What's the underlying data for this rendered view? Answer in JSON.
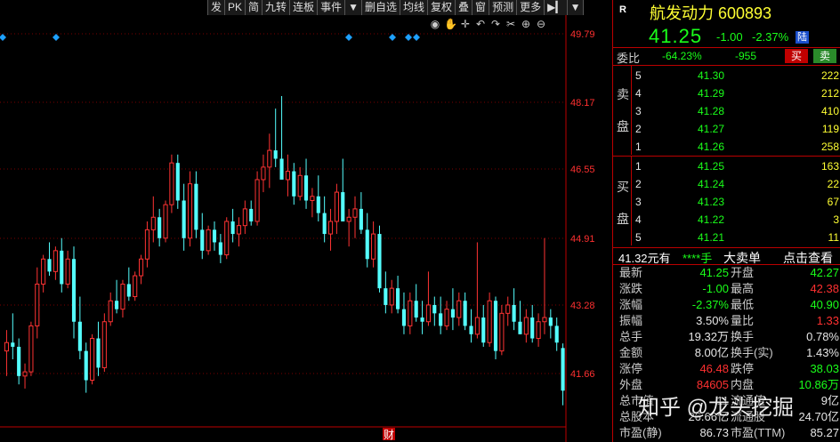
{
  "toolbar": {
    "buttons": [
      "发",
      "PK",
      "简",
      "九转",
      "连板",
      "事件",
      "▼",
      "删自选",
      "均线",
      "复权",
      "叠",
      "窗",
      "预测",
      "更多",
      "▶▎",
      "▼"
    ]
  },
  "chart": {
    "price_labels": [
      "49.79",
      "48.17",
      "46.55",
      "44.91",
      "43.28",
      "41.66"
    ],
    "bottom_marker": "财",
    "candles": [
      [
        42.2,
        42.7,
        41.6,
        42.4
      ],
      [
        42.4,
        43.1,
        42.0,
        42.3
      ],
      [
        42.3,
        42.5,
        41.4,
        41.6
      ],
      [
        41.6,
        41.9,
        41.3,
        41.7
      ],
      [
        41.7,
        42.9,
        41.6,
        42.8
      ],
      [
        42.8,
        44.2,
        42.5,
        43.8
      ],
      [
        43.8,
        44.5,
        43.6,
        44.4
      ],
      [
        44.4,
        44.8,
        44.0,
        44.1
      ],
      [
        44.1,
        44.7,
        43.9,
        44.6
      ],
      [
        44.6,
        44.9,
        43.6,
        43.8
      ],
      [
        43.8,
        44.6,
        43.7,
        44.4
      ],
      [
        44.4,
        44.7,
        42.5,
        42.9
      ],
      [
        42.9,
        43.5,
        42.0,
        42.2
      ],
      [
        42.2,
        42.4,
        41.2,
        41.5
      ],
      [
        41.5,
        42.6,
        41.4,
        42.5
      ],
      [
        42.5,
        42.9,
        41.6,
        41.8
      ],
      [
        41.8,
        43.1,
        41.7,
        42.9
      ],
      [
        42.9,
        43.6,
        42.8,
        43.4
      ],
      [
        43.4,
        43.9,
        43.1,
        43.2
      ],
      [
        43.2,
        43.9,
        43.0,
        43.8
      ],
      [
        43.8,
        44.2,
        43.4,
        43.5
      ],
      [
        43.5,
        44.1,
        43.4,
        44.0
      ],
      [
        44.0,
        44.5,
        43.8,
        44.4
      ],
      [
        44.4,
        45.3,
        44.2,
        45.1
      ],
      [
        45.1,
        45.9,
        44.8,
        45.4
      ],
      [
        45.4,
        45.6,
        44.7,
        44.9
      ],
      [
        44.9,
        45.8,
        44.8,
        45.7
      ],
      [
        45.7,
        46.9,
        45.5,
        46.7
      ],
      [
        46.7,
        46.9,
        45.6,
        45.8
      ],
      [
        45.8,
        46.2,
        44.6,
        44.9
      ],
      [
        44.9,
        46.5,
        44.7,
        46.2
      ],
      [
        46.2,
        46.5,
        44.9,
        45.1
      ],
      [
        45.1,
        45.5,
        44.4,
        44.6
      ],
      [
        44.6,
        45.2,
        44.5,
        45.1
      ],
      [
        45.1,
        45.3,
        44.6,
        44.8
      ],
      [
        44.8,
        45.0,
        44.3,
        44.5
      ],
      [
        44.5,
        45.4,
        44.4,
        45.3
      ],
      [
        45.3,
        45.6,
        44.8,
        45.0
      ],
      [
        45.0,
        45.4,
        44.7,
        45.2
      ],
      [
        45.2,
        45.8,
        45.0,
        45.6
      ],
      [
        45.6,
        45.8,
        45.2,
        45.3
      ],
      [
        45.3,
        46.5,
        45.2,
        46.3
      ],
      [
        46.3,
        46.9,
        46.0,
        46.6
      ],
      [
        46.6,
        47.4,
        46.1,
        47.0
      ],
      [
        47.0,
        48.0,
        46.6,
        46.8
      ],
      [
        46.8,
        48.3,
        46.4,
        46.3
      ],
      [
        46.3,
        46.9,
        45.9,
        46.5
      ],
      [
        46.5,
        46.7,
        45.7,
        45.9
      ],
      [
        45.9,
        46.6,
        45.8,
        46.4
      ],
      [
        46.4,
        46.8,
        45.6,
        45.8
      ],
      [
        45.8,
        46.1,
        45.4,
        45.9
      ],
      [
        45.9,
        46.4,
        45.3,
        45.5
      ],
      [
        45.5,
        45.9,
        44.8,
        45.0
      ],
      [
        45.0,
        45.6,
        44.6,
        45.3
      ],
      [
        45.3,
        46.2,
        45.0,
        46.0
      ],
      [
        46.0,
        46.8,
        45.4,
        45.3
      ],
      [
        45.3,
        45.6,
        44.7,
        45.4
      ],
      [
        45.4,
        45.9,
        44.9,
        45.6
      ],
      [
        45.6,
        46.0,
        45.0,
        45.1
      ],
      [
        45.1,
        45.5,
        44.2,
        44.4
      ],
      [
        44.4,
        45.3,
        44.2,
        45.0
      ],
      [
        45.0,
        45.2,
        43.6,
        43.7
      ],
      [
        43.7,
        44.1,
        43.1,
        43.3
      ],
      [
        43.3,
        43.9,
        43.1,
        43.7
      ],
      [
        43.7,
        44.0,
        43.1,
        43.2
      ],
      [
        43.2,
        43.6,
        42.6,
        42.8
      ],
      [
        42.8,
        43.6,
        42.6,
        43.4
      ],
      [
        43.4,
        43.8,
        42.9,
        43.0
      ],
      [
        43.0,
        43.4,
        42.6,
        42.9
      ],
      [
        42.9,
        44.1,
        42.8,
        43.3
      ],
      [
        43.3,
        43.5,
        42.8,
        43.1
      ],
      [
        43.1,
        43.5,
        42.6,
        42.8
      ],
      [
        42.8,
        43.4,
        42.7,
        43.2
      ],
      [
        43.2,
        43.7,
        42.7,
        43.0
      ],
      [
        43.0,
        43.6,
        42.8,
        43.4
      ],
      [
        43.4,
        43.6,
        42.7,
        42.8
      ],
      [
        42.8,
        43.2,
        42.4,
        42.6
      ],
      [
        42.6,
        44.8,
        42.5,
        43.0
      ],
      [
        43.0,
        43.3,
        42.3,
        42.4
      ],
      [
        42.4,
        43.6,
        42.3,
        43.4
      ],
      [
        43.4,
        43.5,
        42.0,
        42.2
      ],
      [
        42.2,
        43.3,
        42.1,
        43.1
      ],
      [
        43.1,
        43.5,
        42.8,
        43.3
      ],
      [
        43.3,
        43.7,
        42.7,
        42.9
      ],
      [
        42.9,
        43.4,
        42.6,
        42.6
      ],
      [
        42.6,
        43.2,
        42.4,
        43.0
      ],
      [
        43.0,
        43.3,
        42.4,
        42.5
      ],
      [
        42.5,
        43.1,
        42.3,
        42.9
      ],
      [
        42.9,
        44.9,
        42.6,
        43.0
      ],
      [
        43.0,
        43.2,
        42.5,
        42.8
      ],
      [
        42.8,
        43.0,
        42.2,
        42.4
      ],
      [
        42.27,
        42.38,
        40.9,
        41.25
      ]
    ]
  },
  "quote": {
    "market_tag": "R",
    "name_code": "航发动力 600893",
    "price": "41.25",
    "change": "-1.00",
    "change_pct": "-2.37%",
    "tag": "陆",
    "wei_label": "委比",
    "wei_bi": "-64.23%",
    "wei_cha": "-955",
    "buy_btn": "买",
    "sell_btn": "卖",
    "sell_side_label": [
      "卖",
      "盘"
    ],
    "buy_side_label": [
      "买",
      "盘"
    ],
    "asks": [
      {
        "level": "5",
        "price": "41.30",
        "vol": "222"
      },
      {
        "level": "4",
        "price": "41.29",
        "vol": "212"
      },
      {
        "level": "3",
        "price": "41.28",
        "vol": "410"
      },
      {
        "level": "2",
        "price": "41.27",
        "vol": "119"
      },
      {
        "level": "1",
        "price": "41.26",
        "vol": "258"
      }
    ],
    "bids": [
      {
        "level": "1",
        "price": "41.25",
        "vol": "163"
      },
      {
        "level": "2",
        "price": "41.24",
        "vol": "22"
      },
      {
        "level": "3",
        "price": "41.23",
        "vol": "67"
      },
      {
        "level": "4",
        "price": "41.22",
        "vol": "3"
      },
      {
        "level": "5",
        "price": "41.21",
        "vol": "11"
      }
    ],
    "bigorder": {
      "price": "41.32元有",
      "stars": "****手",
      "label": "大卖单",
      "link": "点击查看"
    },
    "stats": [
      {
        "l1": "最新",
        "v1": "41.25",
        "c1": "green",
        "l2": "开盘",
        "v2": "42.27",
        "c2": "green"
      },
      {
        "l1": "涨跌",
        "v1": "-1.00",
        "c1": "green",
        "l2": "最高",
        "v2": "42.38",
        "c2": "red"
      },
      {
        "l1": "涨幅",
        "v1": "-2.37%",
        "c1": "green",
        "l2": "最低",
        "v2": "40.90",
        "c2": "green"
      },
      {
        "l1": "振幅",
        "v1": "3.50%",
        "c1": "white",
        "l2": "量比",
        "v2": "1.33",
        "c2": "red"
      },
      {
        "l1": "总手",
        "v1": "19.32万",
        "c1": "white",
        "l2": "换手",
        "v2": "0.78%",
        "c2": "white"
      },
      {
        "l1": "金额",
        "v1": "8.00亿",
        "c1": "white",
        "l2": "换手(实)",
        "v2": "1.43%",
        "c2": "white"
      },
      {
        "l1": "涨停",
        "v1": "46.48",
        "c1": "red",
        "l2": "跌停",
        "v2": "38.03",
        "c2": "green"
      },
      {
        "l1": "外盘",
        "v1": "84605",
        "c1": "red",
        "l2": "内盘",
        "v2": "10.86万",
        "c2": "green"
      },
      {
        "l1": "总市值",
        "v1": "11",
        "c1": "white",
        "l2": "流通值",
        "v2": "9亿",
        "c2": "white"
      },
      {
        "l1": "总股本",
        "v1": "26.66亿",
        "c1": "white",
        "l2": "流通股",
        "v2": "24.70亿",
        "c2": "white"
      },
      {
        "l1": "市盈(静)",
        "v1": "86.73",
        "c1": "white",
        "l2": "市盈(TTM)",
        "v2": "85.27",
        "c2": "white"
      }
    ],
    "watermark": "知乎 @龙头挖掘"
  },
  "colors": {
    "up": "#ff3333",
    "down": "#54ffff",
    "grid": "#7a0000",
    "diamond": "#1ea0ff"
  }
}
